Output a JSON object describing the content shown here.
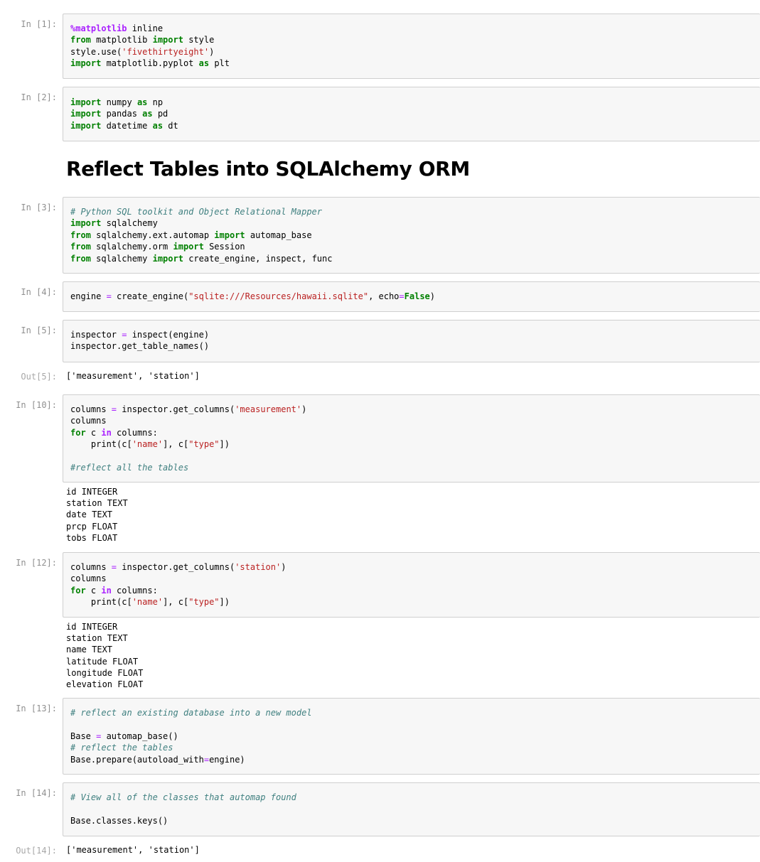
{
  "notebook": {
    "heading": "Reflect Tables into SQLAlchemy ORM",
    "cells": [
      {
        "prompt": "In [1]:",
        "lines": [
          [
            [
              "mg",
              "%matplotlib"
            ],
            [
              "pl",
              " inline"
            ]
          ],
          [
            [
              "kw",
              "from"
            ],
            [
              "pl",
              " matplotlib "
            ],
            [
              "kw",
              "import"
            ],
            [
              "pl",
              " style"
            ]
          ],
          [
            [
              "pl",
              "style.use("
            ],
            [
              "st",
              "'fivethirtyeight'"
            ],
            [
              "pl",
              ")"
            ]
          ],
          [
            [
              "kw",
              "import"
            ],
            [
              "pl",
              " matplotlib.pyplot "
            ],
            [
              "kw",
              "as"
            ],
            [
              "pl",
              " plt"
            ]
          ]
        ]
      },
      {
        "prompt": "In [2]:",
        "lines": [
          [
            [
              "kw",
              "import"
            ],
            [
              "pl",
              " numpy "
            ],
            [
              "kw",
              "as"
            ],
            [
              "pl",
              " np"
            ]
          ],
          [
            [
              "kw",
              "import"
            ],
            [
              "pl",
              " pandas "
            ],
            [
              "kw",
              "as"
            ],
            [
              "pl",
              " pd"
            ]
          ],
          [
            [
              "kw",
              "import"
            ],
            [
              "pl",
              " datetime "
            ],
            [
              "kw",
              "as"
            ],
            [
              "pl",
              " dt"
            ]
          ]
        ]
      },
      {
        "prompt": "In [3]:",
        "lines": [
          [
            [
              "cm",
              "# Python SQL toolkit and Object Relational Mapper"
            ]
          ],
          [
            [
              "kw",
              "import"
            ],
            [
              "pl",
              " sqlalchemy"
            ]
          ],
          [
            [
              "kw",
              "from"
            ],
            [
              "pl",
              " sqlalchemy.ext.automap "
            ],
            [
              "kw",
              "import"
            ],
            [
              "pl",
              " automap_base"
            ]
          ],
          [
            [
              "kw",
              "from"
            ],
            [
              "pl",
              " sqlalchemy.orm "
            ],
            [
              "kw",
              "import"
            ],
            [
              "pl",
              " Session"
            ]
          ],
          [
            [
              "kw",
              "from"
            ],
            [
              "pl",
              " sqlalchemy "
            ],
            [
              "kw",
              "import"
            ],
            [
              "pl",
              " create_engine, inspect, func"
            ]
          ]
        ]
      },
      {
        "prompt": "In [4]:",
        "lines": [
          [
            [
              "pl",
              "engine "
            ],
            [
              "op",
              "="
            ],
            [
              "pl",
              " create_engine("
            ],
            [
              "st",
              "\"sqlite:///Resources/hawaii.sqlite\""
            ],
            [
              "pl",
              ", echo"
            ],
            [
              "op",
              "="
            ],
            [
              "kw",
              "False"
            ],
            [
              "pl",
              ")"
            ]
          ]
        ]
      },
      {
        "prompt": "In [5]:",
        "lines": [
          [
            [
              "pl",
              "inspector "
            ],
            [
              "op",
              "="
            ],
            [
              "pl",
              " inspect(engine)"
            ]
          ],
          [
            [
              "pl",
              "inspector.get_table_names()"
            ]
          ]
        ]
      },
      {
        "prompt": "In [10]:",
        "lines": [
          [
            [
              "pl",
              "columns "
            ],
            [
              "op",
              "="
            ],
            [
              "pl",
              " inspector.get_columns("
            ],
            [
              "st",
              "'measurement'"
            ],
            [
              "pl",
              ")"
            ]
          ],
          [
            [
              "pl",
              "columns"
            ]
          ],
          [
            [
              "kw",
              "for"
            ],
            [
              "pl",
              " c "
            ],
            [
              "mg",
              "in"
            ],
            [
              "pl",
              " columns:"
            ]
          ],
          [
            [
              "pl",
              "    print(c["
            ],
            [
              "st",
              "'name'"
            ],
            [
              "pl",
              "], c["
            ],
            [
              "st",
              "\"type\""
            ],
            [
              "pl",
              "])"
            ]
          ],
          [
            [
              "pl",
              ""
            ]
          ],
          [
            [
              "cm",
              "#reflect all the tables"
            ]
          ]
        ]
      },
      {
        "prompt": "In [12]:",
        "lines": [
          [
            [
              "pl",
              "columns "
            ],
            [
              "op",
              "="
            ],
            [
              "pl",
              " inspector.get_columns("
            ],
            [
              "st",
              "'station'"
            ],
            [
              "pl",
              ")"
            ]
          ],
          [
            [
              "pl",
              "columns"
            ]
          ],
          [
            [
              "kw",
              "for"
            ],
            [
              "pl",
              " c "
            ],
            [
              "mg",
              "in"
            ],
            [
              "pl",
              " columns:"
            ]
          ],
          [
            [
              "pl",
              "    print(c["
            ],
            [
              "st",
              "'name'"
            ],
            [
              "pl",
              "], c["
            ],
            [
              "st",
              "\"type\""
            ],
            [
              "pl",
              "])"
            ]
          ]
        ]
      },
      {
        "prompt": "In [13]:",
        "lines": [
          [
            [
              "cm",
              "# reflect an existing database into a new model"
            ]
          ],
          [
            [
              "pl",
              ""
            ]
          ],
          [
            [
              "pl",
              "Base "
            ],
            [
              "op",
              "="
            ],
            [
              "pl",
              " automap_base()"
            ]
          ],
          [
            [
              "cm",
              "# reflect the tables"
            ]
          ],
          [
            [
              "pl",
              "Base.prepare(autoload_with"
            ],
            [
              "op",
              "="
            ],
            [
              "pl",
              "engine)"
            ]
          ]
        ]
      },
      {
        "prompt": "In [14]:",
        "lines": [
          [
            [
              "cm",
              "# View all of the classes that automap found"
            ]
          ],
          [
            [
              "pl",
              ""
            ]
          ],
          [
            [
              "pl",
              "Base.classes.keys()"
            ]
          ]
        ]
      }
    ],
    "outputs": [
      {
        "prompt": "Out[5]:",
        "text": "['measurement', 'station']"
      },
      {
        "prompt": "",
        "text": "id INTEGER\nstation TEXT\ndate TEXT\nprcp FLOAT\ntobs FLOAT"
      },
      {
        "prompt": "",
        "text": "id INTEGER\nstation TEXT\nname TEXT\nlatitude FLOAT\nlongitude FLOAT\nelevation FLOAT"
      },
      {
        "prompt": "Out[14]:",
        "text": "['measurement', 'station']"
      }
    ]
  }
}
